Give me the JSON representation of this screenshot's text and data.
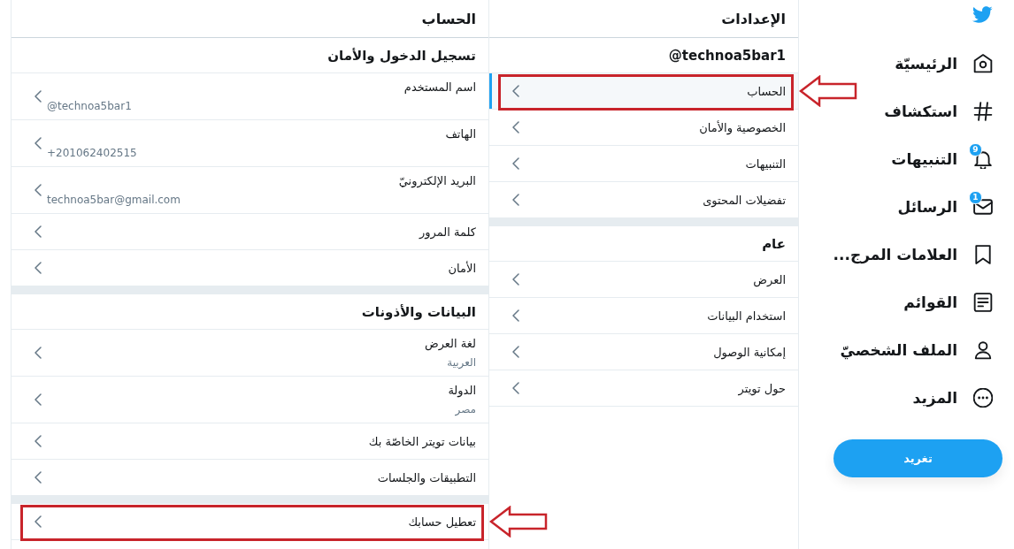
{
  "nav": {
    "items": [
      {
        "label": "الرئيسيّة"
      },
      {
        "label": "استكشاف"
      },
      {
        "label": "التنبيهات",
        "badge": "9"
      },
      {
        "label": "الرسائل",
        "badge": "1"
      },
      {
        "label": "العلامات المرج..."
      },
      {
        "label": "القوائم"
      },
      {
        "label": "الملف الشخصيّ"
      },
      {
        "label": "المزيد"
      }
    ],
    "tweet_button": "تغريد"
  },
  "settings": {
    "title": "الإعدادات",
    "sections": [
      {
        "heading": "@technoa5bar1",
        "items": [
          {
            "label": "الحساب",
            "selected": true,
            "highlighted": true
          },
          {
            "label": "الخصوصية والأمان",
            "selected": false,
            "highlighted": false
          },
          {
            "label": "التنبيهات",
            "selected": false,
            "highlighted": false
          },
          {
            "label": "تفضيلات المحتوى",
            "selected": false,
            "highlighted": false
          }
        ]
      },
      {
        "heading": "عام",
        "items": [
          {
            "label": "العرض",
            "selected": false,
            "highlighted": false
          },
          {
            "label": "استخدام البيانات",
            "selected": false,
            "highlighted": false
          },
          {
            "label": "إمكانية الوصول",
            "selected": false,
            "highlighted": false
          },
          {
            "label": "حول تويتر",
            "selected": false,
            "highlighted": false
          }
        ]
      }
    ]
  },
  "account": {
    "title": "الحساب",
    "sections": [
      {
        "heading": "تسجيل الدخول والأمان",
        "items": [
          {
            "label": "اسم المستخدم",
            "value": "@technoa5bar1",
            "highlighted": false
          },
          {
            "label": "الهاتف",
            "value": "+201062402515",
            "highlighted": false
          },
          {
            "label": "البريد الإلكترونيّ",
            "value": "technoa5bar@gmail.com",
            "highlighted": false
          },
          {
            "label": "كلمة المرور",
            "highlighted": false
          },
          {
            "label": "الأمان",
            "highlighted": false
          }
        ]
      },
      {
        "heading": "البيانات والأذونات",
        "items": [
          {
            "label": "لغة العرض",
            "value": "العربية",
            "highlighted": false
          },
          {
            "label": "الدولة",
            "value": "مصر",
            "highlighted": false
          },
          {
            "label": "بيانات تويتر الخاصّة بك",
            "highlighted": false
          },
          {
            "label": "التطبيقات والجلسات",
            "highlighted": false
          }
        ]
      },
      {
        "items": [
          {
            "label": "تعطيل حسابك",
            "highlighted": true
          }
        ]
      }
    ]
  }
}
